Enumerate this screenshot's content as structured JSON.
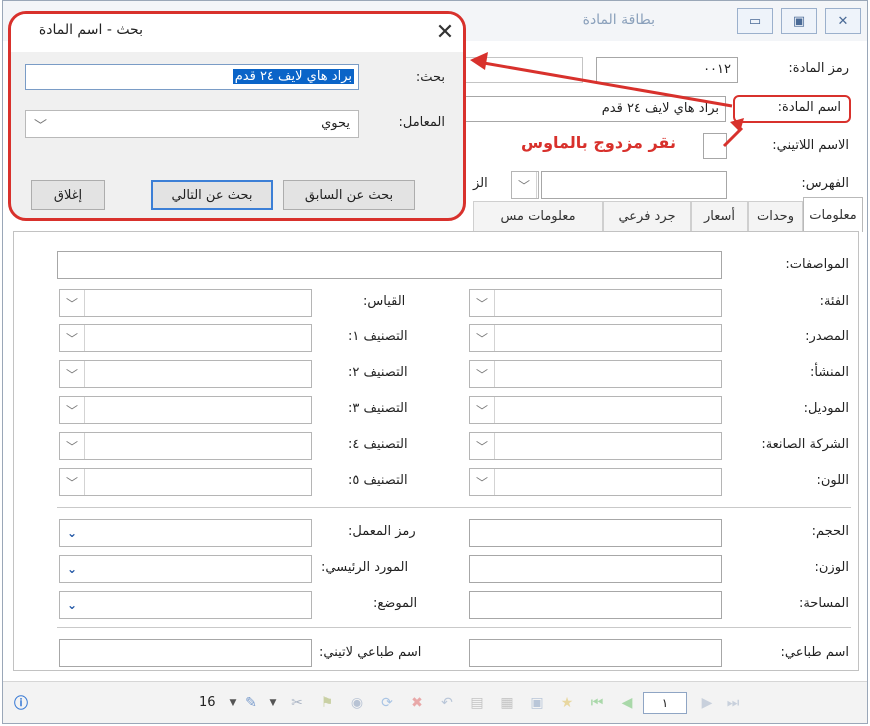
{
  "window": {
    "title": "بطاقة المادة"
  },
  "header": {
    "code_label": "رمز المادة:",
    "code_value": "٠٠١٢",
    "name_label": "اسم المادة:",
    "name_value": "براد هاي لايف ٢٤ قدم",
    "latin_label": "الاسم اللاتيني:",
    "index_label": "الفهرس:",
    "index_partial_label": "الز"
  },
  "annotation": {
    "text": "نقر مزدوج بالماوس"
  },
  "tabs": [
    {
      "label": "معلومات"
    },
    {
      "label": "وحدات"
    },
    {
      "label": "أسعار"
    },
    {
      "label": "جرد فرعي"
    },
    {
      "label": "معلومات مس"
    }
  ],
  "info": {
    "specs_label": "المواصفات:",
    "rows": [
      {
        "right_label": "الفئة:",
        "left_label": "القياس:"
      },
      {
        "right_label": "المصدر:",
        "left_label": "التصنيف ١:"
      },
      {
        "right_label": "المنشأ:",
        "left_label": "التصنيف ٢:"
      },
      {
        "right_label": "الموديل:",
        "left_label": "التصنيف ٣:"
      },
      {
        "right_label": "الشركة الصانعة:",
        "left_label": "التصنيف ٤:"
      },
      {
        "right_label": "اللون:",
        "left_label": "التصنيف ٥:"
      }
    ],
    "rows2": [
      {
        "right_label": "الحجم:",
        "left_label": "رمز المعمل:"
      },
      {
        "right_label": "الوزن:",
        "left_label": "المورد الرئيسي:"
      },
      {
        "right_label": "المساحة:",
        "left_label": "الموضع:"
      }
    ],
    "print_name_label": "اسم طباعي:",
    "print_latin_label": "اسم طباعي لاتيني:"
  },
  "dialog": {
    "title": "بحث - اسم المادة",
    "search_label": "بحث:",
    "search_value": "براد هاي لايف ٢٤ قدم",
    "operator_label": "المعامل:",
    "operator_value": "يحوي",
    "prev_button": "بحث عن السابق",
    "next_button": "بحث عن التالي",
    "close_button": "إغلاق"
  },
  "statusbar": {
    "page_size": "16",
    "record": "١"
  }
}
